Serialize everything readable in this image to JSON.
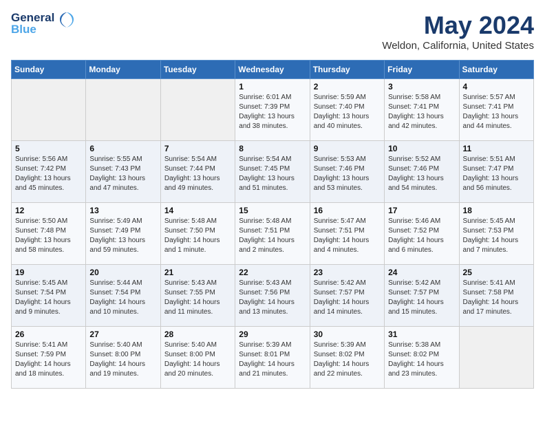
{
  "header": {
    "logo_line1": "General",
    "logo_line2": "Blue",
    "month": "May 2024",
    "location": "Weldon, California, United States"
  },
  "days_of_week": [
    "Sunday",
    "Monday",
    "Tuesday",
    "Wednesday",
    "Thursday",
    "Friday",
    "Saturday"
  ],
  "weeks": [
    [
      {
        "day": "",
        "info": ""
      },
      {
        "day": "",
        "info": ""
      },
      {
        "day": "",
        "info": ""
      },
      {
        "day": "1",
        "info": "Sunrise: 6:01 AM\nSunset: 7:39 PM\nDaylight: 13 hours\nand 38 minutes."
      },
      {
        "day": "2",
        "info": "Sunrise: 5:59 AM\nSunset: 7:40 PM\nDaylight: 13 hours\nand 40 minutes."
      },
      {
        "day": "3",
        "info": "Sunrise: 5:58 AM\nSunset: 7:41 PM\nDaylight: 13 hours\nand 42 minutes."
      },
      {
        "day": "4",
        "info": "Sunrise: 5:57 AM\nSunset: 7:41 PM\nDaylight: 13 hours\nand 44 minutes."
      }
    ],
    [
      {
        "day": "5",
        "info": "Sunrise: 5:56 AM\nSunset: 7:42 PM\nDaylight: 13 hours\nand 45 minutes."
      },
      {
        "day": "6",
        "info": "Sunrise: 5:55 AM\nSunset: 7:43 PM\nDaylight: 13 hours\nand 47 minutes."
      },
      {
        "day": "7",
        "info": "Sunrise: 5:54 AM\nSunset: 7:44 PM\nDaylight: 13 hours\nand 49 minutes."
      },
      {
        "day": "8",
        "info": "Sunrise: 5:54 AM\nSunset: 7:45 PM\nDaylight: 13 hours\nand 51 minutes."
      },
      {
        "day": "9",
        "info": "Sunrise: 5:53 AM\nSunset: 7:46 PM\nDaylight: 13 hours\nand 53 minutes."
      },
      {
        "day": "10",
        "info": "Sunrise: 5:52 AM\nSunset: 7:46 PM\nDaylight: 13 hours\nand 54 minutes."
      },
      {
        "day": "11",
        "info": "Sunrise: 5:51 AM\nSunset: 7:47 PM\nDaylight: 13 hours\nand 56 minutes."
      }
    ],
    [
      {
        "day": "12",
        "info": "Sunrise: 5:50 AM\nSunset: 7:48 PM\nDaylight: 13 hours\nand 58 minutes."
      },
      {
        "day": "13",
        "info": "Sunrise: 5:49 AM\nSunset: 7:49 PM\nDaylight: 13 hours\nand 59 minutes."
      },
      {
        "day": "14",
        "info": "Sunrise: 5:48 AM\nSunset: 7:50 PM\nDaylight: 14 hours\nand 1 minute."
      },
      {
        "day": "15",
        "info": "Sunrise: 5:48 AM\nSunset: 7:51 PM\nDaylight: 14 hours\nand 2 minutes."
      },
      {
        "day": "16",
        "info": "Sunrise: 5:47 AM\nSunset: 7:51 PM\nDaylight: 14 hours\nand 4 minutes."
      },
      {
        "day": "17",
        "info": "Sunrise: 5:46 AM\nSunset: 7:52 PM\nDaylight: 14 hours\nand 6 minutes."
      },
      {
        "day": "18",
        "info": "Sunrise: 5:45 AM\nSunset: 7:53 PM\nDaylight: 14 hours\nand 7 minutes."
      }
    ],
    [
      {
        "day": "19",
        "info": "Sunrise: 5:45 AM\nSunset: 7:54 PM\nDaylight: 14 hours\nand 9 minutes."
      },
      {
        "day": "20",
        "info": "Sunrise: 5:44 AM\nSunset: 7:54 PM\nDaylight: 14 hours\nand 10 minutes."
      },
      {
        "day": "21",
        "info": "Sunrise: 5:43 AM\nSunset: 7:55 PM\nDaylight: 14 hours\nand 11 minutes."
      },
      {
        "day": "22",
        "info": "Sunrise: 5:43 AM\nSunset: 7:56 PM\nDaylight: 14 hours\nand 13 minutes."
      },
      {
        "day": "23",
        "info": "Sunrise: 5:42 AM\nSunset: 7:57 PM\nDaylight: 14 hours\nand 14 minutes."
      },
      {
        "day": "24",
        "info": "Sunrise: 5:42 AM\nSunset: 7:57 PM\nDaylight: 14 hours\nand 15 minutes."
      },
      {
        "day": "25",
        "info": "Sunrise: 5:41 AM\nSunset: 7:58 PM\nDaylight: 14 hours\nand 17 minutes."
      }
    ],
    [
      {
        "day": "26",
        "info": "Sunrise: 5:41 AM\nSunset: 7:59 PM\nDaylight: 14 hours\nand 18 minutes."
      },
      {
        "day": "27",
        "info": "Sunrise: 5:40 AM\nSunset: 8:00 PM\nDaylight: 14 hours\nand 19 minutes."
      },
      {
        "day": "28",
        "info": "Sunrise: 5:40 AM\nSunset: 8:00 PM\nDaylight: 14 hours\nand 20 minutes."
      },
      {
        "day": "29",
        "info": "Sunrise: 5:39 AM\nSunset: 8:01 PM\nDaylight: 14 hours\nand 21 minutes."
      },
      {
        "day": "30",
        "info": "Sunrise: 5:39 AM\nSunset: 8:02 PM\nDaylight: 14 hours\nand 22 minutes."
      },
      {
        "day": "31",
        "info": "Sunrise: 5:38 AM\nSunset: 8:02 PM\nDaylight: 14 hours\nand 23 minutes."
      },
      {
        "day": "",
        "info": ""
      }
    ]
  ]
}
